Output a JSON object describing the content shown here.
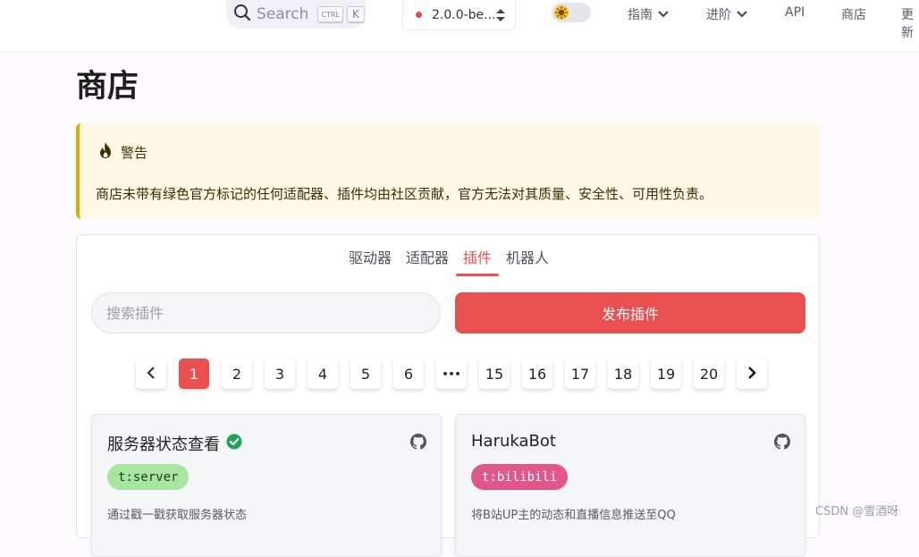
{
  "navbar": {
    "search_label": "Search",
    "search_kbd_ctrl": "CTRL",
    "search_kbd_k": "K",
    "version": "2.0.0-be...",
    "theme_icon": "sun-icon",
    "items": [
      {
        "label": "指南",
        "has_dropdown": true
      },
      {
        "label": "进阶",
        "has_dropdown": true
      },
      {
        "label": "API",
        "has_dropdown": false
      },
      {
        "label": "商店",
        "has_dropdown": false
      },
      {
        "label": "更新",
        "has_dropdown": false
      }
    ]
  },
  "page": {
    "title": "商店"
  },
  "warning": {
    "title": "警告",
    "icon": "fire-icon",
    "body": "商店未带有绿色官方标记的任何适配器、插件均由社区贡献，官方无法对其质量、安全性、可用性负责。"
  },
  "store": {
    "tabs": [
      {
        "label": "驱动器",
        "active": false
      },
      {
        "label": "适配器",
        "active": false
      },
      {
        "label": "插件",
        "active": true
      },
      {
        "label": "机器人",
        "active": false
      }
    ],
    "search_placeholder": "搜索插件",
    "publish_label": "发布插件",
    "pagination": {
      "prev_icon": "chevron-left-icon",
      "next_icon": "chevron-right-icon",
      "current": "1",
      "pages": [
        "1",
        "2",
        "3",
        "4",
        "5",
        "6",
        "•••",
        "15",
        "16",
        "17",
        "18",
        "19",
        "20"
      ]
    },
    "cards": [
      {
        "title": "服务器状态查看",
        "official": true,
        "tag": "t:server",
        "tag_bg": "#a6e6a0",
        "description": "通过戳一戳获取服务器状态"
      },
      {
        "title": "HarukaBot",
        "official": false,
        "tag": "t:bilibili",
        "tag_bg": "#e2578a",
        "description": "将B站UP主的动态和直播信息推送至QQ"
      }
    ]
  },
  "watermark": "CSDN @雪酒呀",
  "colors": {
    "accent": "#e95151",
    "warning_bg": "#fff8e6",
    "warning_border": "#e6a700",
    "official_check": "#1fa35a"
  }
}
